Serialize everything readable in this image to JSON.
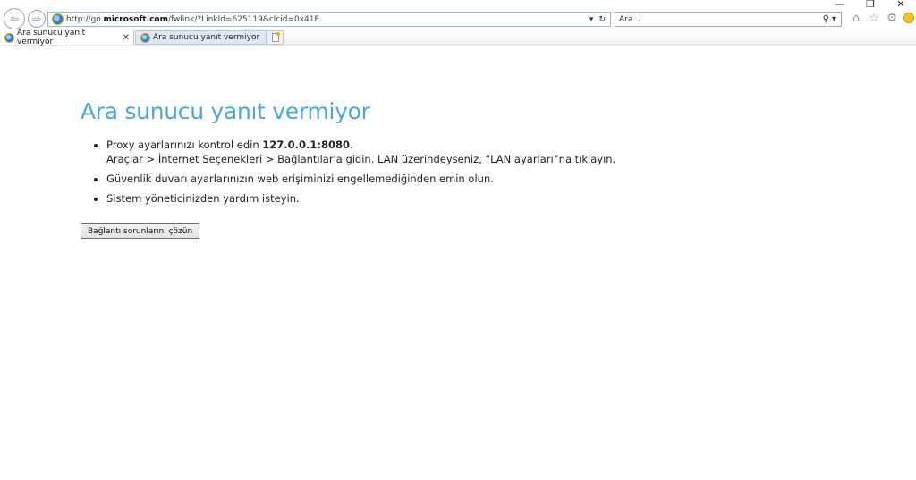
{
  "window": {
    "minimize_glyph": "—",
    "restore_glyph": "❐",
    "close_glyph": "✕"
  },
  "toolbar": {
    "address_prefix": "http://go.",
    "address_domain": "microsoft.com",
    "address_path": "/fwlink/?LinkId=625119&clcid=0x41F",
    "search_placeholder": "Ara...",
    "icons": [
      "back-icon",
      "forward-icon",
      "dropdown-icon",
      "refresh-icon",
      "search-icon",
      "home-icon",
      "favorites-star-icon",
      "settings-gear-icon",
      "smiley-feedback-icon"
    ]
  },
  "tabs": [
    {
      "label": "Ara sunucu yanıt vermiyor",
      "active": true
    },
    {
      "label": "Ara sunucu yanıt vermiyor",
      "active": false
    }
  ],
  "page": {
    "title": "Ara sunucu yanıt vermiyor",
    "tip1_prefix": "Proxy ayarlarınızı kontrol edin ",
    "tip1_address": "127.0.0.1:8080",
    "tip1_suffix": ".",
    "tip1_line2": "Araçlar > İnternet Seçenekleri > Bağlantılar'a gidin. LAN üzerindeyseniz, “LAN ayarları”na tıklayın.",
    "tip2": "Güvenlik duvarı ayarlarınızın web erişiminizi engellemediğinden emin olun.",
    "tip3": "Sistem yöneticinizden yardım isteyin.",
    "fix_button": "Bağlantı sorunlarını çözün"
  }
}
